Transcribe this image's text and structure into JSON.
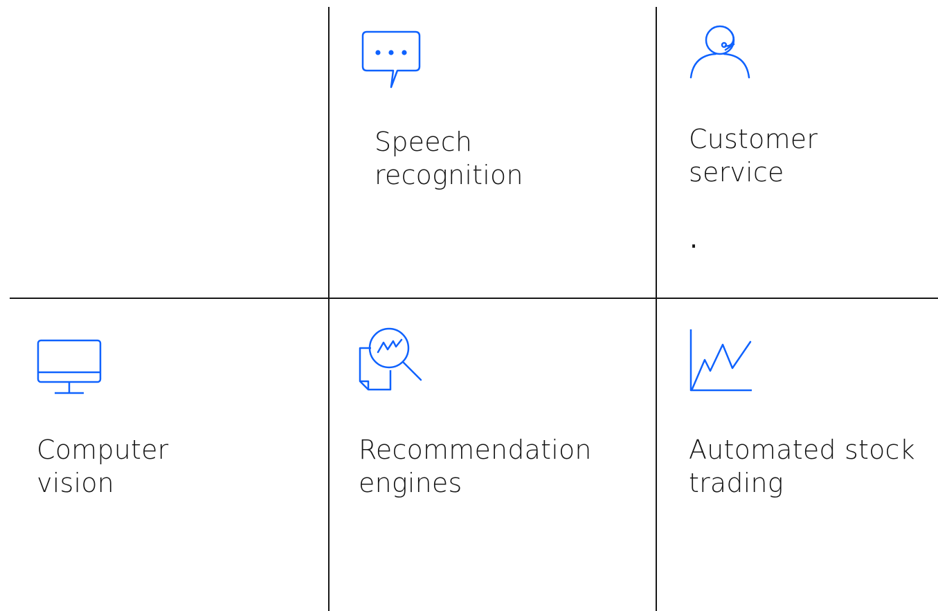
{
  "accent_color": "#0f62fe",
  "cells": [
    {
      "id": "speech-recognition",
      "icon": "chat-bubble-icon",
      "label_lines": [
        "Speech",
        "recognition"
      ]
    },
    {
      "id": "customer-service",
      "icon": "agent-headset-icon",
      "label_lines": [
        "Customer",
        "service"
      ],
      "note": "."
    },
    {
      "id": "computer-vision",
      "icon": "monitor-icon",
      "label_lines": [
        "Computer",
        "vision"
      ]
    },
    {
      "id": "recommendation-engines",
      "icon": "document-search-icon",
      "label_lines": [
        "Recommendation",
        "engines"
      ]
    },
    {
      "id": "automated-stock-trading",
      "icon": "line-chart-icon",
      "label_lines": [
        "Automated stock",
        "trading"
      ]
    }
  ]
}
